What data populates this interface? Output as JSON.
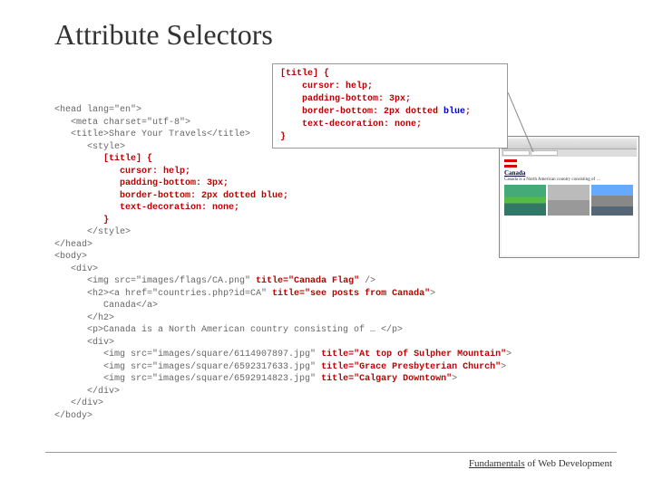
{
  "title": "Attribute Selectors",
  "callout": {
    "selector": "[title] {",
    "p1": "cursor: help;",
    "p2": "padding-bottom: 3px;",
    "p3a": "border-bottom: 2px dotted ",
    "p3b": "blue",
    "p3c": ";",
    "p4": "text-decoration: none;",
    "close": "}"
  },
  "code": {
    "l1": "<head lang=\"en\">",
    "l2": "   <meta charset=\"utf-8\">",
    "l3": "   <title>Share Your Travels</title>",
    "l4": "      <style>",
    "l5": "         [title] {",
    "l6": "            cursor: help;",
    "l7": "            padding-bottom: 3px;",
    "l8": "            border-bottom: 2px dotted blue;",
    "l9": "            text-decoration: none;",
    "l10": "         }",
    "l11": "      </style>",
    "l12": "</head>",
    "l13": "<body>",
    "l14": "   <div>",
    "l15a": "      <img src=\"images/flags/CA.png\" ",
    "l15b": "title=\"Canada Flag\"",
    "l15c": " />",
    "l16a": "      <h2><a href=\"countries.php?id=CA\" ",
    "l16b": "title=\"see posts from Canada\"",
    "l16c": ">",
    "l17": "         Canada</a>",
    "l18": "      </h2>",
    "l19": "      <p>Canada is a North American country consisting of … </p>",
    "l20": "      <div>",
    "l21a": "         <img src=\"images/square/6114907897.jpg\" ",
    "l21b": "title=\"At top of Sulpher Mountain\"",
    "l21c": ">",
    "l22a": "         <img src=\"images/square/6592317633.jpg\" ",
    "l22b": "title=\"Grace Presbyterian Church\"",
    "l22c": ">",
    "l23a": "         <img src=\"images/square/6592914823.jpg\" ",
    "l23b": "title=\"Calgary Downtown\"",
    "l23c": ">",
    "l24": "      </div>",
    "l25": "   </div>",
    "l26": "</body>"
  },
  "browser": {
    "heading": "Canada",
    "para": "Canada is a North American country consisting of …"
  },
  "footer": {
    "underlined": "Fundamentals",
    "rest": " of Web Development"
  }
}
